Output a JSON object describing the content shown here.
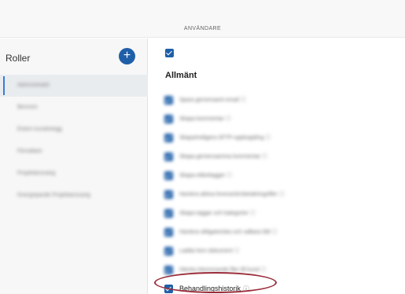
{
  "header": {
    "title": "ANVÄNDARE"
  },
  "sidebar": {
    "title": "Roller",
    "add_icon": "plus-icon",
    "items": [
      {
        "label": "Administratör",
        "active": true
      },
      {
        "label": "Bevnom"
      },
      {
        "label": "Extern kundrelogg"
      },
      {
        "label": "Förvaltare"
      },
      {
        "label": "Projektansvarig"
      },
      {
        "label": "Övergripande Projektansvarig"
      }
    ]
  },
  "main": {
    "section_title": "Allmänt",
    "permissions": [
      {
        "label": "Spara gemensamt email ⓘ",
        "blurred": true
      },
      {
        "label": "Skapa kommentar ⓘ",
        "blurred": true
      },
      {
        "label": "Skapa/redigera SFTP-uppkoppling ⓘ",
        "blurred": true
      },
      {
        "label": "Skapa gemensamma kommentar ⓘ",
        "blurred": true
      },
      {
        "label": "Skapa etikettagger ⓘ",
        "blurred": true
      },
      {
        "label": "Hantera aktiva leverantörsbetalningsfiler ⓘ",
        "blurred": true
      },
      {
        "label": "Skapa taggar och kategorier ⓘ",
        "blurred": true
      },
      {
        "label": "Hantera obligatoriska och valbara fält ⓘ",
        "blurred": true
      },
      {
        "label": "Ladda hem dokument ⓘ",
        "blurred": true
      },
      {
        "label": "Hämta inkommande filer till kund ⓘ",
        "blurred": true
      },
      {
        "label": "Behandlingshistorik",
        "blurred": false,
        "info_icon": "info-circle-icon"
      }
    ]
  },
  "colors": {
    "accent": "#1f5fa8",
    "highlight": "#9b2c3a"
  }
}
